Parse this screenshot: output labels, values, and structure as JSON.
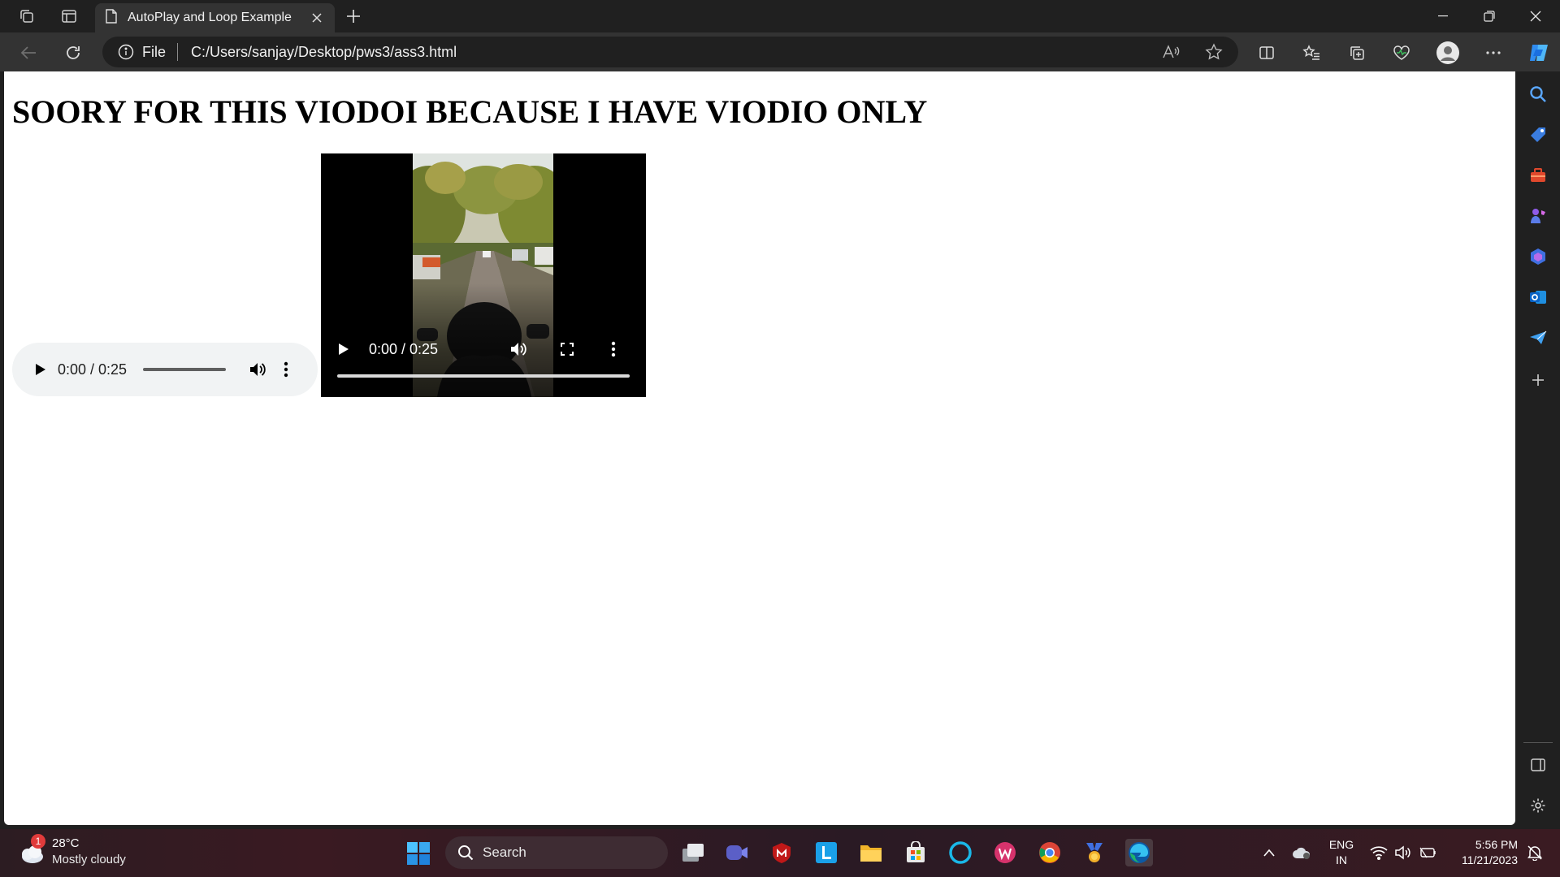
{
  "browser": {
    "tab_title": "AutoPlay and Loop Example",
    "address_scheme": "File",
    "address_url": "C:/Users/sanjay/Desktop/pws3/ass3.html"
  },
  "page": {
    "heading": "SOORY FOR THIS VIODOI BECAUSE I HAVE VIODIO ONLY",
    "audio_player": {
      "time": "0:00 / 0:25"
    },
    "video_player": {
      "time": "0:00 / 0:25"
    }
  },
  "taskbar": {
    "weather": {
      "badge": "1",
      "temp": "28°C",
      "desc": "Mostly cloudy"
    },
    "search_label": "Search",
    "language": {
      "line1": "ENG",
      "line2": "IN"
    },
    "clock": {
      "time": "5:56 PM",
      "date": "11/21/2023"
    }
  },
  "colors": {
    "accent": "#0078d4",
    "taskbar_bg": "#2c1c22",
    "page_bg": "#ffffff"
  }
}
